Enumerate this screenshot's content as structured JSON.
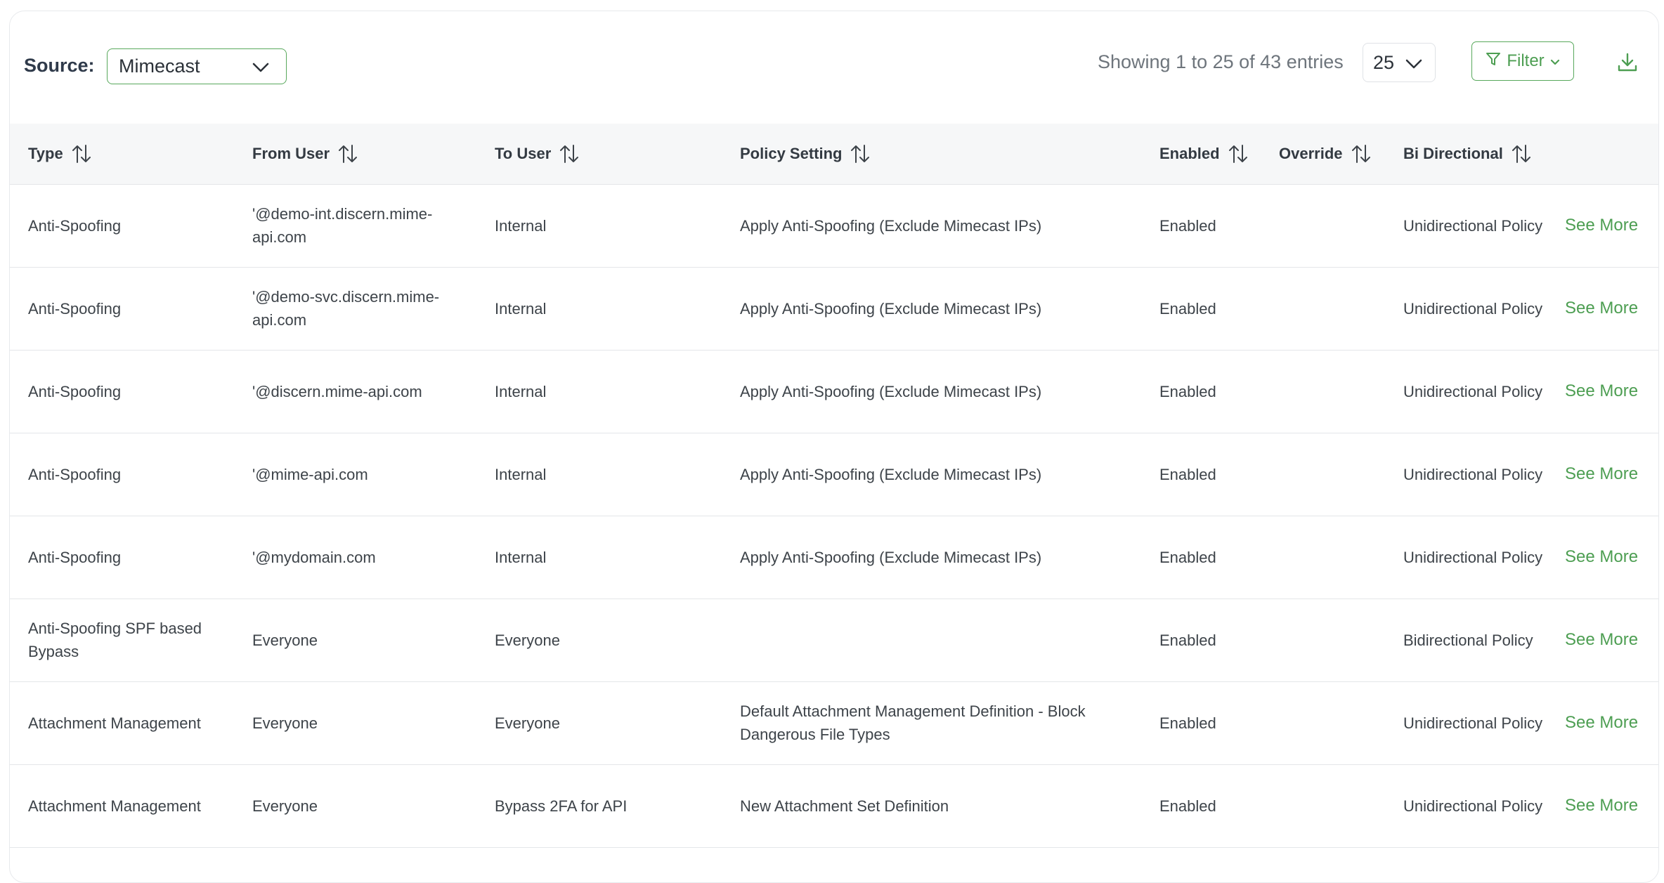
{
  "toolbar": {
    "source_label": "Source:",
    "source_value": "Mimecast",
    "entries_text": "Showing 1 to 25 of 43 entries",
    "page_size": "25",
    "filter_label": "Filter"
  },
  "columns": [
    "Type",
    "From User",
    "To User",
    "Policy Setting",
    "Enabled",
    "Override",
    "Bi Directional"
  ],
  "see_more_label": "See More",
  "rows": [
    {
      "type": "Anti-Spoofing",
      "from_user": "'@demo-int.discern.mime-api.com",
      "to_user": "Internal",
      "policy_setting": "Apply Anti-Spoofing (Exclude Mimecast IPs)",
      "enabled": "Enabled",
      "override": "",
      "bi_directional": "Unidirectional Policy"
    },
    {
      "type": "Anti-Spoofing",
      "from_user": "'@demo-svc.discern.mime-api.com",
      "to_user": "Internal",
      "policy_setting": "Apply Anti-Spoofing (Exclude Mimecast IPs)",
      "enabled": "Enabled",
      "override": "",
      "bi_directional": "Unidirectional Policy"
    },
    {
      "type": "Anti-Spoofing",
      "from_user": "'@discern.mime-api.com",
      "to_user": "Internal",
      "policy_setting": "Apply Anti-Spoofing (Exclude Mimecast IPs)",
      "enabled": "Enabled",
      "override": "",
      "bi_directional": "Unidirectional Policy"
    },
    {
      "type": "Anti-Spoofing",
      "from_user": "'@mime-api.com",
      "to_user": "Internal",
      "policy_setting": "Apply Anti-Spoofing (Exclude Mimecast IPs)",
      "enabled": "Enabled",
      "override": "",
      "bi_directional": "Unidirectional Policy"
    },
    {
      "type": "Anti-Spoofing",
      "from_user": "'@mydomain.com",
      "to_user": "Internal",
      "policy_setting": "Apply Anti-Spoofing (Exclude Mimecast IPs)",
      "enabled": "Enabled",
      "override": "",
      "bi_directional": "Unidirectional Policy"
    },
    {
      "type": "Anti-Spoofing SPF based Bypass",
      "from_user": "Everyone",
      "to_user": "Everyone",
      "policy_setting": "",
      "enabled": "Enabled",
      "override": "",
      "bi_directional": "Bidirectional Policy"
    },
    {
      "type": "Attachment Management",
      "from_user": "Everyone",
      "to_user": "Everyone",
      "policy_setting": "Default Attachment Management Definition - Block Dangerous File Types",
      "enabled": "Enabled",
      "override": "",
      "bi_directional": "Unidirectional Policy"
    },
    {
      "type": "Attachment Management",
      "from_user": "Everyone",
      "to_user": "Bypass 2FA for API",
      "policy_setting": "New Attachment Set Definition",
      "enabled": "Enabled",
      "override": "",
      "bi_directional": "Unidirectional Policy"
    }
  ]
}
